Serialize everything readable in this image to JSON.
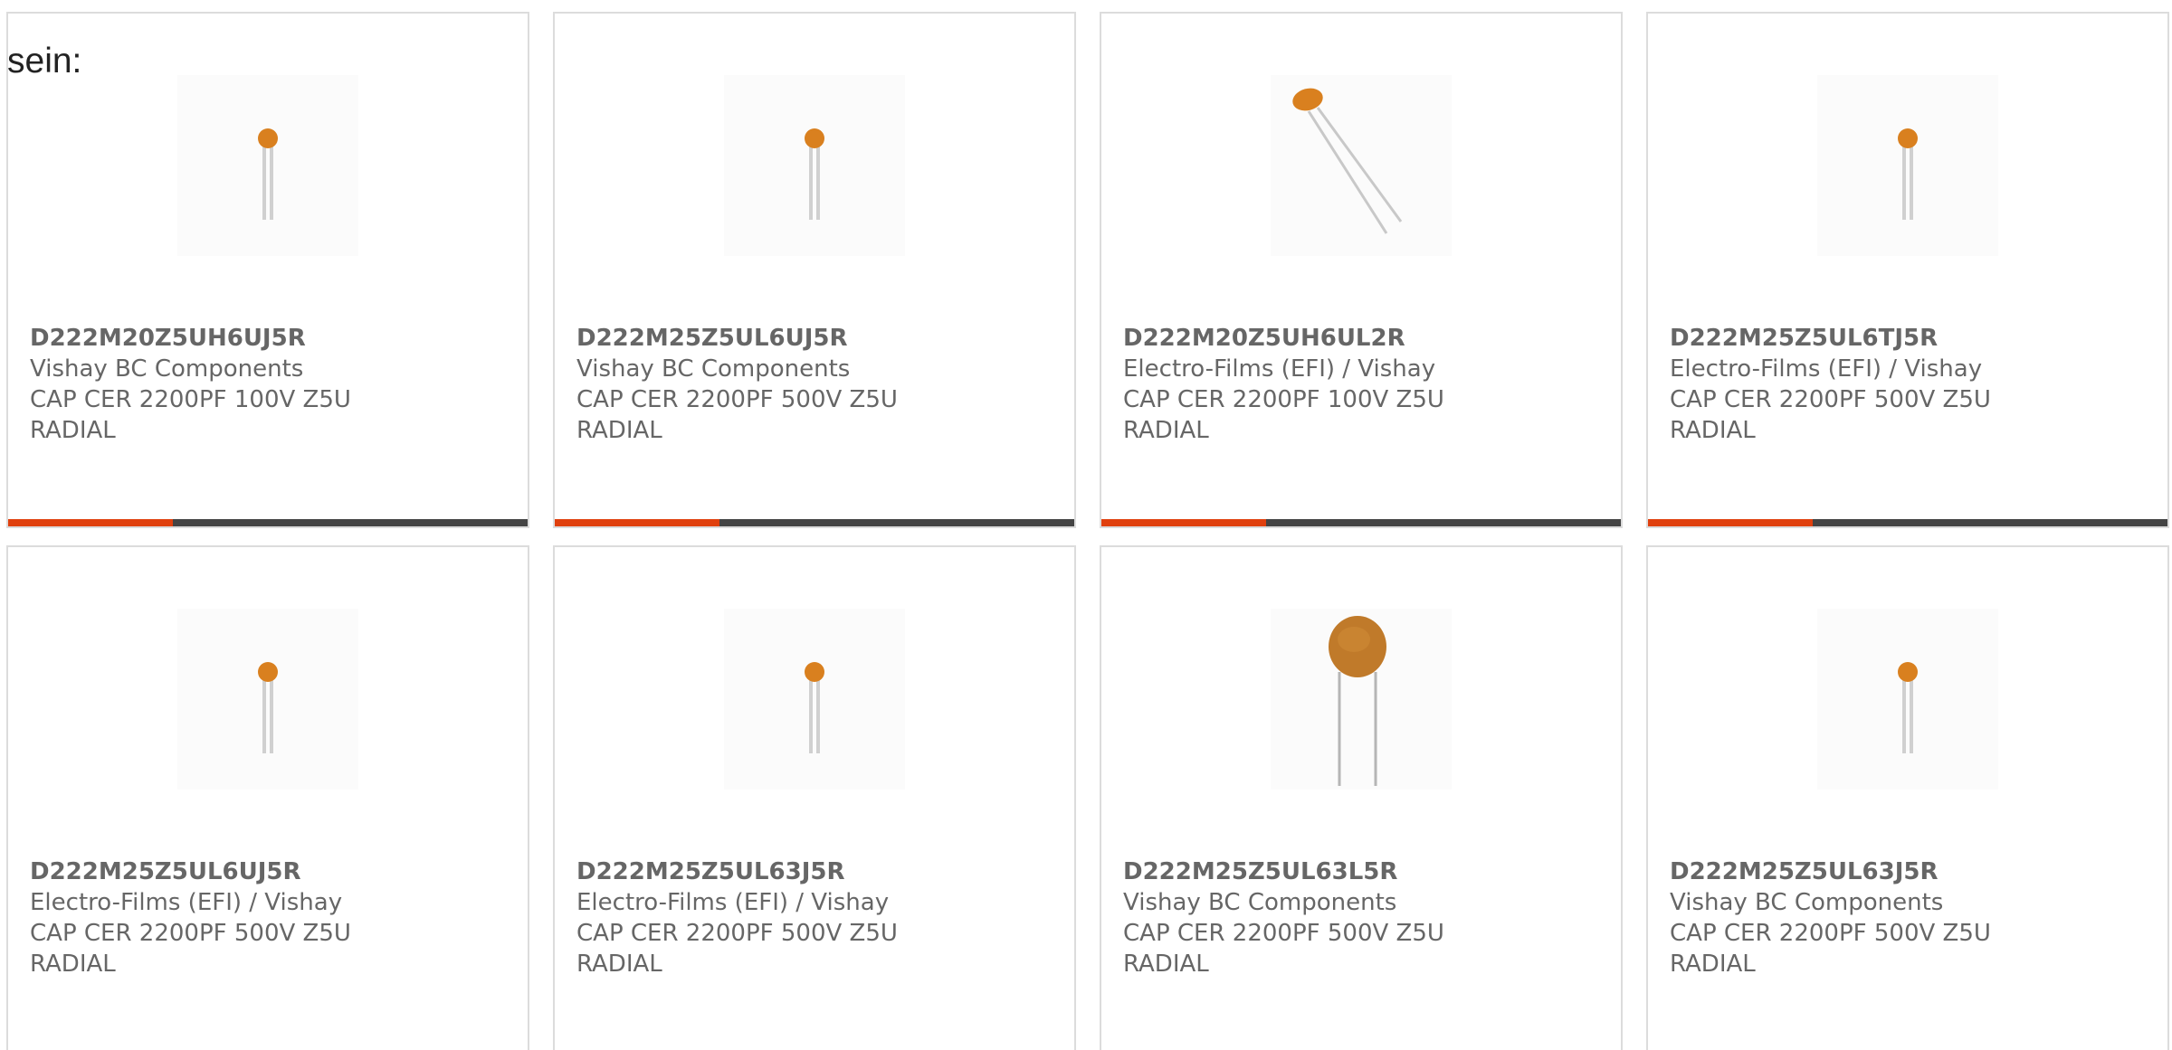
{
  "intro_text": "sein:",
  "colors": {
    "accent": "#e0400e",
    "bar": "#444444",
    "text": "#666666"
  },
  "products": [
    {
      "part": "D222M20Z5UH6UJ5R",
      "maker": "Vishay BC Components",
      "desc1": "CAP CER 2200PF 100V Z5U",
      "desc2": "RADIAL",
      "icon": "small-ceramic-capacitor-icon"
    },
    {
      "part": "D222M25Z5UL6UJ5R",
      "maker": "Vishay BC Components",
      "desc1": "CAP CER 2200PF 500V Z5U",
      "desc2": "RADIAL",
      "icon": "small-ceramic-capacitor-icon"
    },
    {
      "part": "D222M20Z5UH6UL2R",
      "maker": "Electro-Films (EFI) / Vishay",
      "desc1": "CAP CER 2200PF 100V Z5U",
      "desc2": "RADIAL",
      "icon": "bent-ceramic-capacitor-icon"
    },
    {
      "part": "D222M25Z5UL6TJ5R",
      "maker": "Electro-Films (EFI) / Vishay",
      "desc1": "CAP CER 2200PF 500V Z5U",
      "desc2": "RADIAL",
      "icon": "small-ceramic-capacitor-icon"
    },
    {
      "part": "D222M25Z5UL6UJ5R",
      "maker": "Electro-Films (EFI) / Vishay",
      "desc1": "CAP CER 2200PF 500V Z5U",
      "desc2": "RADIAL",
      "icon": "small-ceramic-capacitor-icon"
    },
    {
      "part": "D222M25Z5UL63J5R",
      "maker": "Electro-Films (EFI) / Vishay",
      "desc1": "CAP CER 2200PF 500V Z5U",
      "desc2": "RADIAL",
      "icon": "small-ceramic-capacitor-icon"
    },
    {
      "part": "D222M25Z5UL63L5R",
      "maker": "Vishay BC Components",
      "desc1": "CAP CER 2200PF 500V Z5U",
      "desc2": "RADIAL",
      "icon": "large-disc-capacitor-icon"
    },
    {
      "part": "D222M25Z5UL63J5R",
      "maker": "Vishay BC Components",
      "desc1": "CAP CER 2200PF 500V Z5U",
      "desc2": "RADIAL",
      "icon": "small-ceramic-capacitor-icon"
    }
  ]
}
